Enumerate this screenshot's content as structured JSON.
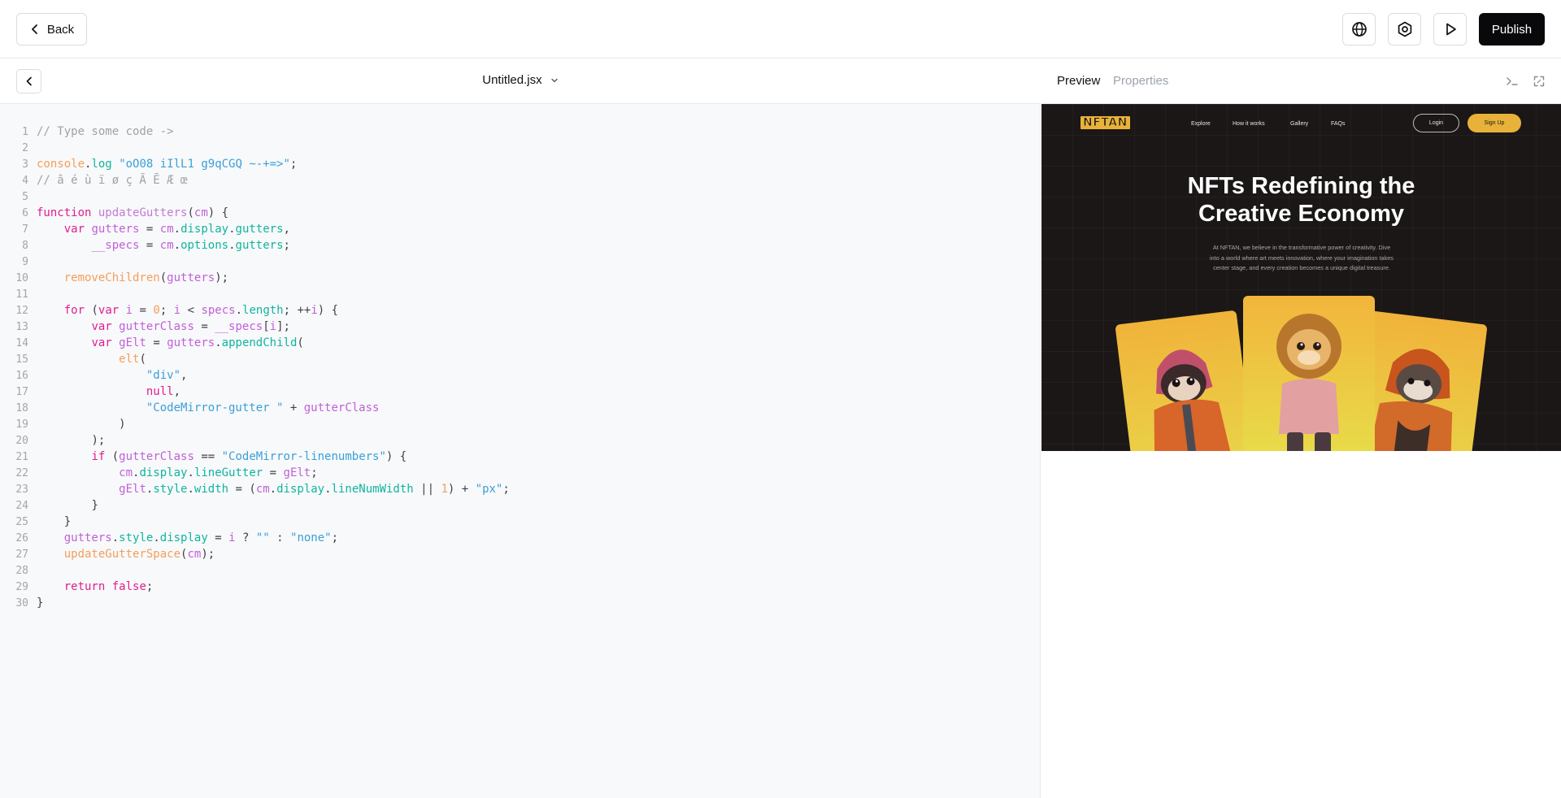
{
  "topbar": {
    "back_label": "Back",
    "icons": [
      "globe-icon",
      "settings-icon",
      "play-icon"
    ],
    "publish_label": "Publish"
  },
  "editor": {
    "file_name": "Untitled.jsx",
    "line_numbers": [
      "1",
      "2",
      "3",
      "4",
      "5",
      "6",
      "7",
      "8",
      "9",
      "10",
      "11",
      "12",
      "13",
      "14",
      "15",
      "16",
      "17",
      "18",
      "19",
      "20",
      "21",
      "22",
      "23",
      "24",
      "25",
      "26",
      "27",
      "28",
      "29",
      "30"
    ],
    "code_lines": [
      "// Type some code ->",
      "",
      "console.log \"oO08 iIlL1 g9qCGQ ~-+=>\";",
      "// â é ù ï ø ç Ã Ē Æ œ",
      "",
      "function updateGutters(cm) {",
      "    var gutters = cm.display.gutters,",
      "        __specs = cm.options.gutters;",
      "",
      "    removeChildren(gutters);",
      "",
      "    for (var i = 0; i < specs.length; ++i) {",
      "        var gutterClass = __specs[i];",
      "        var gElt = gutters.appendChild(",
      "            elt(",
      "                \"div\",",
      "                null,",
      "                \"CodeMirror-gutter \" + gutterClass",
      "            )",
      "        );",
      "        if (gutterClass == \"CodeMirror-linenumbers\") {",
      "            cm.display.lineGutter = gElt;",
      "            gElt.style.width = (cm.display.lineNumWidth || 1) + \"px\";",
      "        }",
      "    }",
      "    gutters.style.display = i ? \"\" : \"none\";",
      "    updateGutterSpace(cm);",
      "",
      "    return false;",
      "}"
    ]
  },
  "preview": {
    "tabs": [
      "Preview",
      "Properties"
    ],
    "header_icons": [
      "terminal-icon",
      "expand-icon"
    ],
    "site": {
      "logo": "NFTAN",
      "nav": [
        "Explore",
        "How it works",
        "Gallery",
        "FAQs"
      ],
      "login_label": "Login",
      "signup_label": "Sign Up",
      "hero_title_line1": "NFTs Redefining the",
      "hero_title_line2": "Creative Economy",
      "hero_sub_line1": "At  NFTAN, we believe in the transformative power of creativity. Dive",
      "hero_sub_line2": "into a world where art meets innovation, where your imagination takes",
      "hero_sub_line3": "center stage, and every creation becomes a unique digital treasure.",
      "accent_color": "#e8b23a",
      "background_color": "#1b1716"
    }
  }
}
